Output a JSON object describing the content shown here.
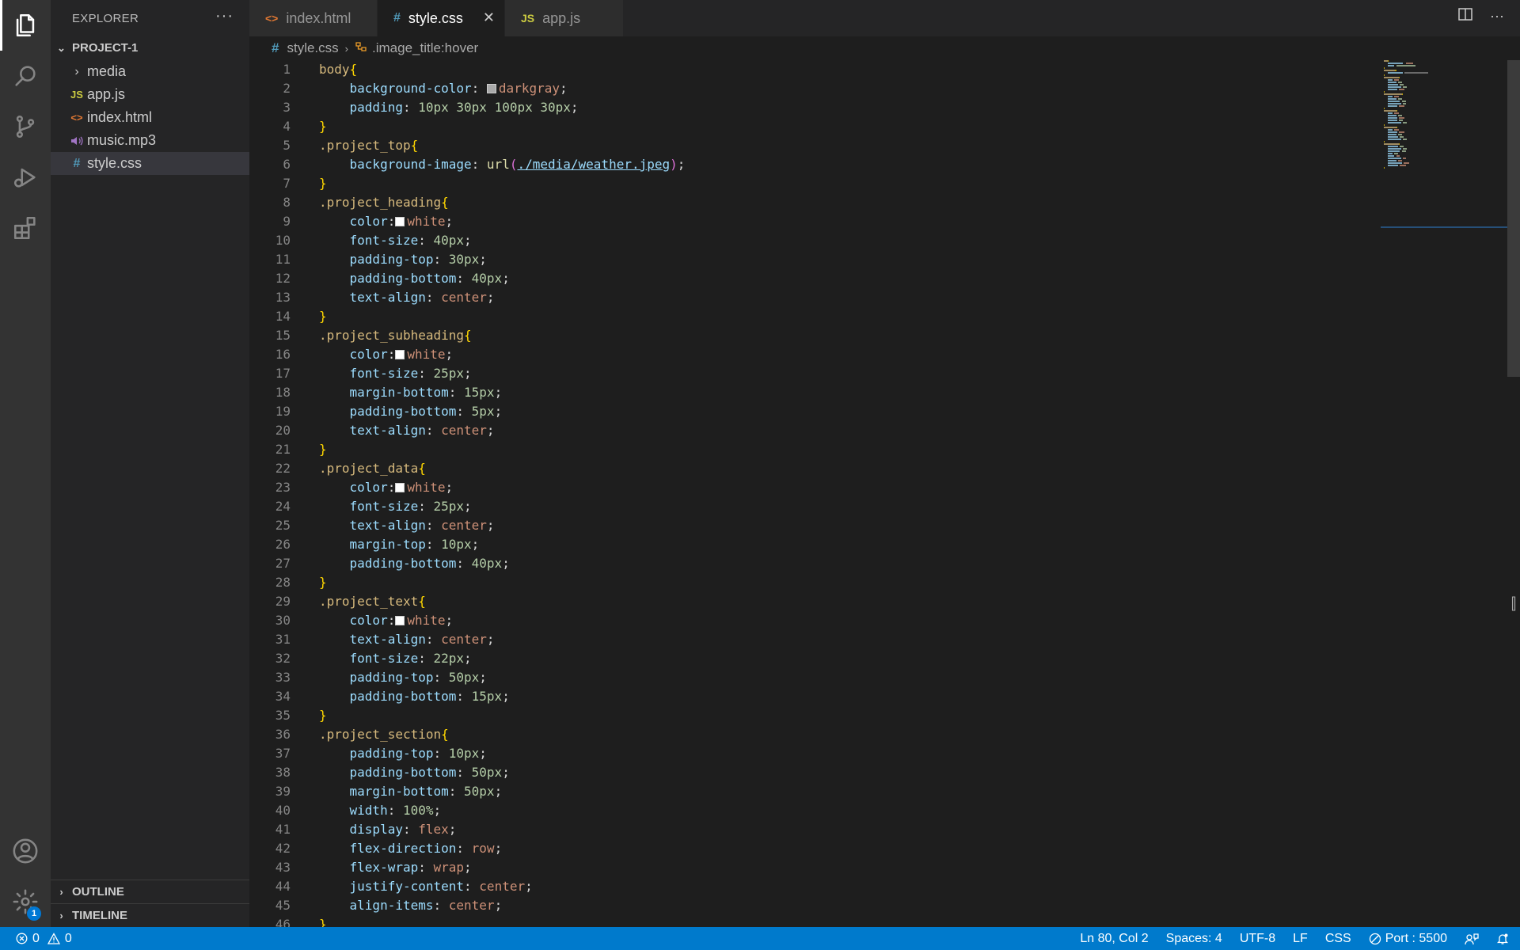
{
  "explorer": {
    "title": "EXPLORER",
    "more": "···",
    "project": "PROJECT-1",
    "files": [
      {
        "name": "media",
        "icon": "chevron-right-icon",
        "type": "folder"
      },
      {
        "name": "app.js",
        "icon": "javascript-file-icon",
        "badge": "JS"
      },
      {
        "name": "index.html",
        "icon": "html-file-icon",
        "badge": "<>"
      },
      {
        "name": "music.mp3",
        "icon": "audio-file-icon",
        "badge": "🔊"
      },
      {
        "name": "style.css",
        "icon": "css-file-icon",
        "badge": "#",
        "selected": true
      }
    ],
    "outline": "OUTLINE",
    "timeline": "TIMELINE"
  },
  "tabs": [
    {
      "label": "index.html",
      "icon": "<>",
      "color": "#e37933"
    },
    {
      "label": "style.css",
      "icon": "#",
      "color": "#519aba",
      "active": true,
      "close": "✕"
    },
    {
      "label": "app.js",
      "icon": "JS",
      "color": "#cbcb41"
    }
  ],
  "breadcrumb": {
    "file": "style.css",
    "symbol": ".image_title:hover"
  },
  "code": [
    [
      [
        "sel",
        "body"
      ],
      [
        "brace",
        "{"
      ]
    ],
    [
      [
        "ind",
        "    "
      ],
      [
        "prop",
        "background-color"
      ],
      [
        "punc",
        ": "
      ],
      [
        "swatch",
        "#a9a9a9"
      ],
      [
        "kw",
        "darkgray"
      ],
      [
        "punc",
        ";"
      ]
    ],
    [
      [
        "ind",
        "    "
      ],
      [
        "prop",
        "padding"
      ],
      [
        "punc",
        ": "
      ],
      [
        "num",
        "10px 30px 100px 30px"
      ],
      [
        "punc",
        ";"
      ]
    ],
    [
      [
        "brace",
        "}"
      ]
    ],
    [
      [
        "sel",
        ".project_top"
      ],
      [
        "brace",
        "{"
      ]
    ],
    [
      [
        "ind",
        "    "
      ],
      [
        "prop",
        "background-image"
      ],
      [
        "punc",
        ": "
      ],
      [
        "fn",
        "url"
      ],
      [
        "paren",
        "("
      ],
      [
        "url",
        "./media/weather.jpeg"
      ],
      [
        "paren",
        ")"
      ],
      [
        "punc",
        ";"
      ]
    ],
    [
      [
        "brace",
        "}"
      ]
    ],
    [
      [
        "sel",
        ".project_heading"
      ],
      [
        "brace",
        "{"
      ]
    ],
    [
      [
        "ind",
        "    "
      ],
      [
        "prop",
        "color"
      ],
      [
        "punc",
        ":"
      ],
      [
        "swatch",
        "#ffffff"
      ],
      [
        "kw",
        "white"
      ],
      [
        "punc",
        ";"
      ]
    ],
    [
      [
        "ind",
        "    "
      ],
      [
        "prop",
        "font-size"
      ],
      [
        "punc",
        ": "
      ],
      [
        "num",
        "40px"
      ],
      [
        "punc",
        ";"
      ]
    ],
    [
      [
        "ind",
        "    "
      ],
      [
        "prop",
        "padding-top"
      ],
      [
        "punc",
        ": "
      ],
      [
        "num",
        "30px"
      ],
      [
        "punc",
        ";"
      ]
    ],
    [
      [
        "ind",
        "    "
      ],
      [
        "prop",
        "padding-bottom"
      ],
      [
        "punc",
        ": "
      ],
      [
        "num",
        "40px"
      ],
      [
        "punc",
        ";"
      ]
    ],
    [
      [
        "ind",
        "    "
      ],
      [
        "prop",
        "text-align"
      ],
      [
        "punc",
        ": "
      ],
      [
        "kw",
        "center"
      ],
      [
        "punc",
        ";"
      ]
    ],
    [
      [
        "brace",
        "}"
      ]
    ],
    [
      [
        "sel",
        ".project_subheading"
      ],
      [
        "brace",
        "{"
      ]
    ],
    [
      [
        "ind",
        "    "
      ],
      [
        "prop",
        "color"
      ],
      [
        "punc",
        ":"
      ],
      [
        "swatch",
        "#ffffff"
      ],
      [
        "kw",
        "white"
      ],
      [
        "punc",
        ";"
      ]
    ],
    [
      [
        "ind",
        "    "
      ],
      [
        "prop",
        "font-size"
      ],
      [
        "punc",
        ": "
      ],
      [
        "num",
        "25px"
      ],
      [
        "punc",
        ";"
      ]
    ],
    [
      [
        "ind",
        "    "
      ],
      [
        "prop",
        "margin-bottom"
      ],
      [
        "punc",
        ": "
      ],
      [
        "num",
        "15px"
      ],
      [
        "punc",
        ";"
      ]
    ],
    [
      [
        "ind",
        "    "
      ],
      [
        "prop",
        "padding-bottom"
      ],
      [
        "punc",
        ": "
      ],
      [
        "num",
        "5px"
      ],
      [
        "punc",
        ";"
      ]
    ],
    [
      [
        "ind",
        "    "
      ],
      [
        "prop",
        "text-align"
      ],
      [
        "punc",
        ": "
      ],
      [
        "kw",
        "center"
      ],
      [
        "punc",
        ";"
      ]
    ],
    [
      [
        "brace",
        "}"
      ]
    ],
    [
      [
        "sel",
        ".project_data"
      ],
      [
        "brace",
        "{"
      ]
    ],
    [
      [
        "ind",
        "    "
      ],
      [
        "prop",
        "color"
      ],
      [
        "punc",
        ":"
      ],
      [
        "swatch",
        "#ffffff"
      ],
      [
        "kw",
        "white"
      ],
      [
        "punc",
        ";"
      ]
    ],
    [
      [
        "ind",
        "    "
      ],
      [
        "prop",
        "font-size"
      ],
      [
        "punc",
        ": "
      ],
      [
        "num",
        "25px"
      ],
      [
        "punc",
        ";"
      ]
    ],
    [
      [
        "ind",
        "    "
      ],
      [
        "prop",
        "text-align"
      ],
      [
        "punc",
        ": "
      ],
      [
        "kw",
        "center"
      ],
      [
        "punc",
        ";"
      ]
    ],
    [
      [
        "ind",
        "    "
      ],
      [
        "prop",
        "margin-top"
      ],
      [
        "punc",
        ": "
      ],
      [
        "num",
        "10px"
      ],
      [
        "punc",
        ";"
      ]
    ],
    [
      [
        "ind",
        "    "
      ],
      [
        "prop",
        "padding-bottom"
      ],
      [
        "punc",
        ": "
      ],
      [
        "num",
        "40px"
      ],
      [
        "punc",
        ";"
      ]
    ],
    [
      [
        "brace",
        "}"
      ]
    ],
    [
      [
        "sel",
        ".project_text"
      ],
      [
        "brace",
        "{"
      ]
    ],
    [
      [
        "ind",
        "    "
      ],
      [
        "prop",
        "color"
      ],
      [
        "punc",
        ":"
      ],
      [
        "swatch",
        "#ffffff"
      ],
      [
        "kw",
        "white"
      ],
      [
        "punc",
        ";"
      ]
    ],
    [
      [
        "ind",
        "    "
      ],
      [
        "prop",
        "text-align"
      ],
      [
        "punc",
        ": "
      ],
      [
        "kw",
        "center"
      ],
      [
        "punc",
        ";"
      ]
    ],
    [
      [
        "ind",
        "    "
      ],
      [
        "prop",
        "font-size"
      ],
      [
        "punc",
        ": "
      ],
      [
        "num",
        "22px"
      ],
      [
        "punc",
        ";"
      ]
    ],
    [
      [
        "ind",
        "    "
      ],
      [
        "prop",
        "padding-top"
      ],
      [
        "punc",
        ": "
      ],
      [
        "num",
        "50px"
      ],
      [
        "punc",
        ";"
      ]
    ],
    [
      [
        "ind",
        "    "
      ],
      [
        "prop",
        "padding-bottom"
      ],
      [
        "punc",
        ": "
      ],
      [
        "num",
        "15px"
      ],
      [
        "punc",
        ";"
      ]
    ],
    [
      [
        "brace",
        "}"
      ]
    ],
    [
      [
        "sel",
        ".project_section"
      ],
      [
        "brace",
        "{"
      ]
    ],
    [
      [
        "ind",
        "    "
      ],
      [
        "prop",
        "padding-top"
      ],
      [
        "punc",
        ": "
      ],
      [
        "num",
        "10px"
      ],
      [
        "punc",
        ";"
      ]
    ],
    [
      [
        "ind",
        "    "
      ],
      [
        "prop",
        "padding-bottom"
      ],
      [
        "punc",
        ": "
      ],
      [
        "num",
        "50px"
      ],
      [
        "punc",
        ";"
      ]
    ],
    [
      [
        "ind",
        "    "
      ],
      [
        "prop",
        "margin-bottom"
      ],
      [
        "punc",
        ": "
      ],
      [
        "num",
        "50px"
      ],
      [
        "punc",
        ";"
      ]
    ],
    [
      [
        "ind",
        "    "
      ],
      [
        "prop",
        "width"
      ],
      [
        "punc",
        ": "
      ],
      [
        "num",
        "100%"
      ],
      [
        "punc",
        ";"
      ]
    ],
    [
      [
        "ind",
        "    "
      ],
      [
        "prop",
        "display"
      ],
      [
        "punc",
        ": "
      ],
      [
        "kw",
        "flex"
      ],
      [
        "punc",
        ";"
      ]
    ],
    [
      [
        "ind",
        "    "
      ],
      [
        "prop",
        "flex-direction"
      ],
      [
        "punc",
        ": "
      ],
      [
        "kw",
        "row"
      ],
      [
        "punc",
        ";"
      ]
    ],
    [
      [
        "ind",
        "    "
      ],
      [
        "prop",
        "flex-wrap"
      ],
      [
        "punc",
        ": "
      ],
      [
        "kw",
        "wrap"
      ],
      [
        "punc",
        ";"
      ]
    ],
    [
      [
        "ind",
        "    "
      ],
      [
        "prop",
        "justify-content"
      ],
      [
        "punc",
        ": "
      ],
      [
        "kw",
        "center"
      ],
      [
        "punc",
        ";"
      ]
    ],
    [
      [
        "ind",
        "    "
      ],
      [
        "prop",
        "align-items"
      ],
      [
        "punc",
        ": "
      ],
      [
        "kw",
        "center"
      ],
      [
        "punc",
        ";"
      ]
    ],
    [
      [
        "brace",
        "}"
      ]
    ]
  ],
  "status": {
    "errors": "0",
    "warnings": "0",
    "position": "Ln 80, Col 2",
    "spaces": "Spaces: 4",
    "encoding": "UTF-8",
    "eol": "LF",
    "language": "CSS",
    "port": "Port : 5500",
    "notifications_badge": "1"
  },
  "colors": {
    "accent": "#007acc",
    "editor_bg": "#1e1e1e",
    "sidebar_bg": "#252526",
    "activity_bg": "#333333"
  }
}
